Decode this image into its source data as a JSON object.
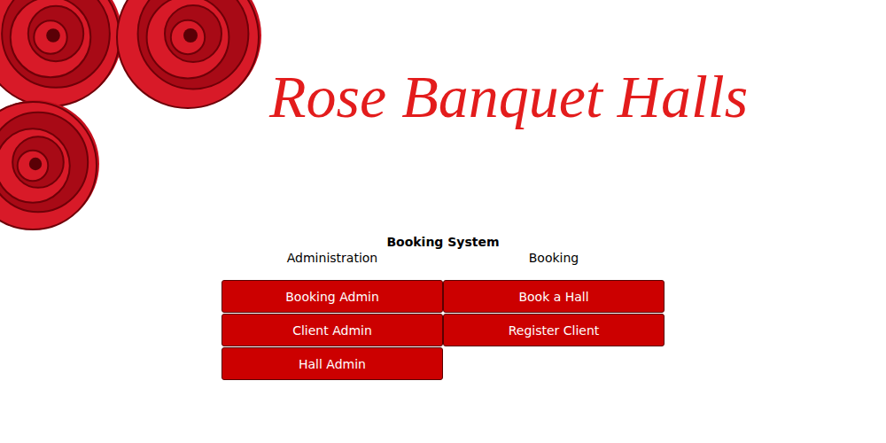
{
  "title": "Rose Banquet Halls",
  "section": "Booking System",
  "columns": [
    {
      "heading": "Administration",
      "buttons": [
        "Booking Admin",
        "Client Admin",
        "Hall Admin"
      ]
    },
    {
      "heading": "Booking",
      "buttons": [
        "Book a Hall",
        "Register Client"
      ]
    }
  ]
}
